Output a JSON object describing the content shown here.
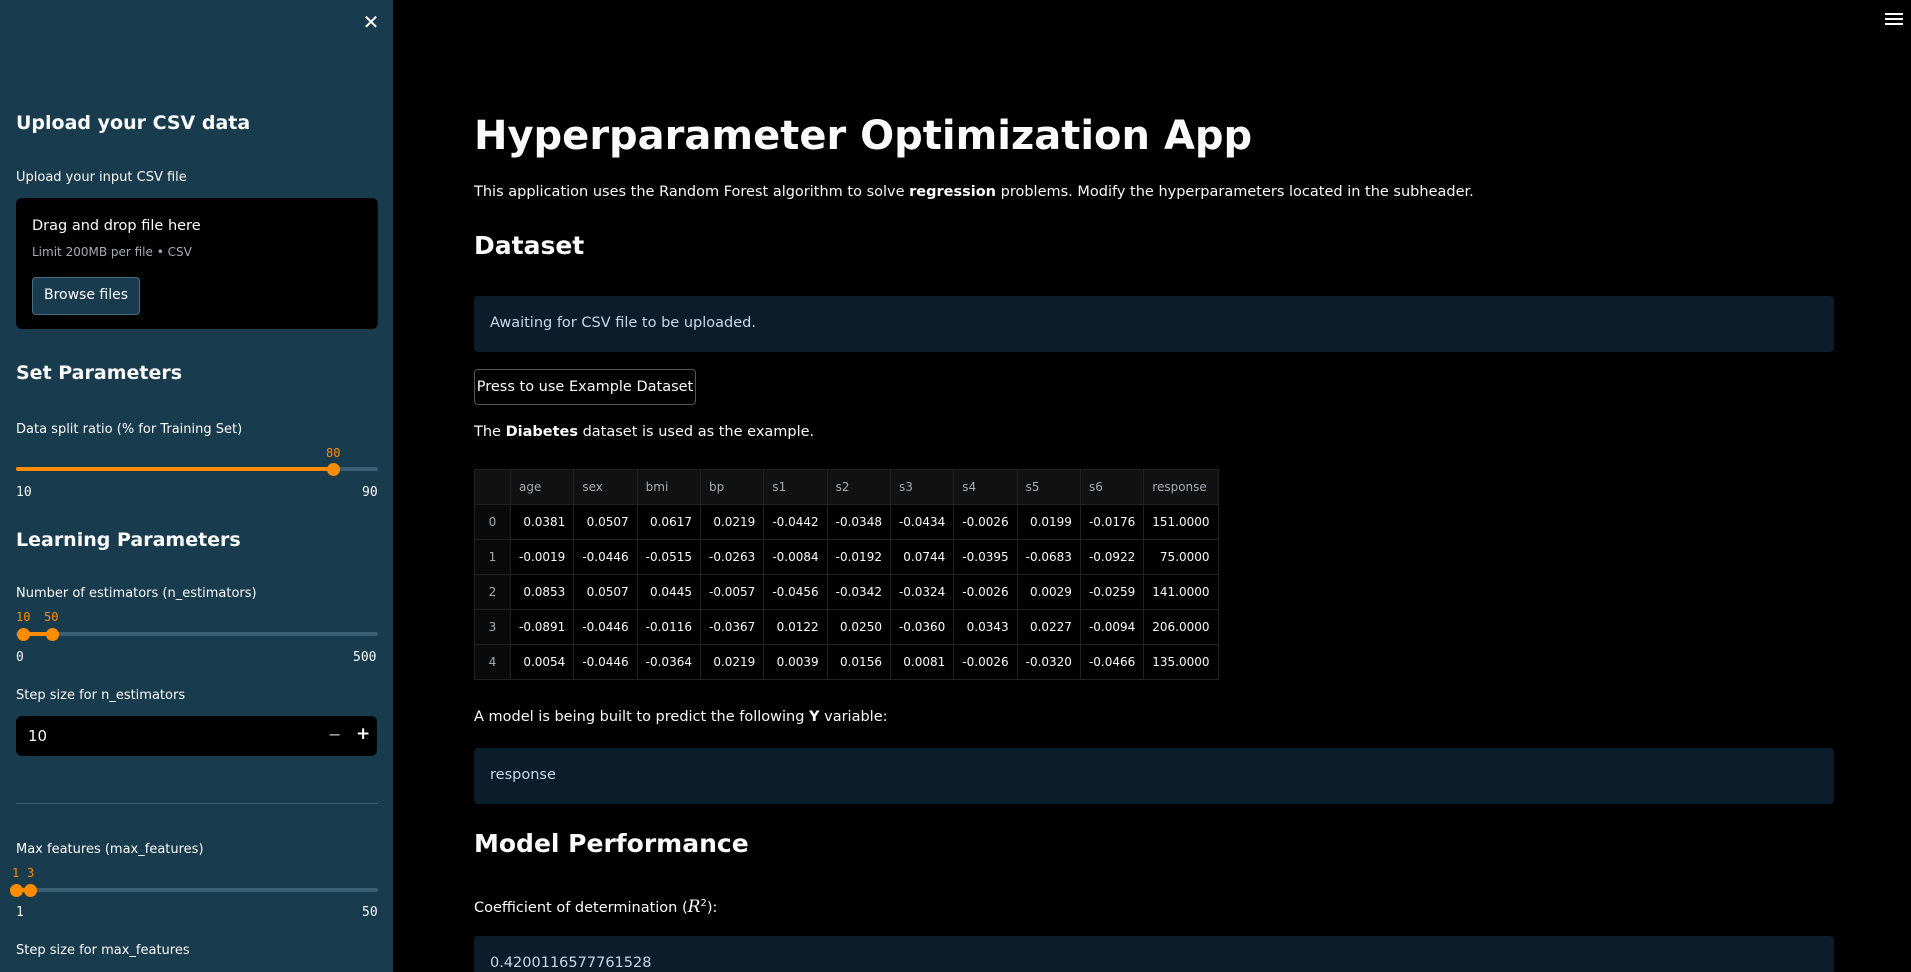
{
  "sidebar": {
    "close_icon": "close-icon",
    "upload_header": "Upload your CSV data",
    "upload_label": "Upload your input CSV file",
    "drag_text": "Drag and drop file here",
    "limit_text": "Limit 200MB per file • CSV",
    "browse_label": "Browse files",
    "set_params_header": "Set Parameters",
    "split_label": "Data split ratio (% for Training Set)",
    "split_value": "80",
    "split_min": "10",
    "split_max": "90",
    "learning_header": "Learning Parameters",
    "estimators_label": "Number of estimators (n_estimators)",
    "estimators_low": "10",
    "estimators_high": "50",
    "estimators_min": "0",
    "estimators_max": "500",
    "step_est_label": "Step size for n_estimators",
    "step_est_value": "10",
    "max_features_label": "Max features (max_features)",
    "max_features_low": "1",
    "max_features_high": "3",
    "max_features_min": "1",
    "max_features_max": "50",
    "step_mf_label": "Step size for max_features"
  },
  "main": {
    "title": "Hyperparameter Optimization App",
    "intro_pre": "This application uses the Random Forest algorithm to solve ",
    "intro_bold": "regression",
    "intro_post": " problems. Modify the hyperparameters located in the subheader.",
    "dataset_header": "Dataset",
    "awaiting": "Awaiting for CSV file to be uploaded.",
    "example_button": "Press to use Example Dataset",
    "example_pre": "The ",
    "example_bold": "Diabetes",
    "example_post": " dataset is used as the example.",
    "table": {
      "columns": [
        "age",
        "sex",
        "bmi",
        "bp",
        "s1",
        "s2",
        "s3",
        "s4",
        "s5",
        "s6",
        "response"
      ],
      "rows": [
        {
          "index": "0",
          "cells": [
            "0.0381",
            "0.0507",
            "0.0617",
            "0.0219",
            "-0.0442",
            "-0.0348",
            "-0.0434",
            "-0.0026",
            "0.0199",
            "-0.0176",
            "151.0000"
          ]
        },
        {
          "index": "1",
          "cells": [
            "-0.0019",
            "-0.0446",
            "-0.0515",
            "-0.0263",
            "-0.0084",
            "-0.0192",
            "0.0744",
            "-0.0395",
            "-0.0683",
            "-0.0922",
            "75.0000"
          ]
        },
        {
          "index": "2",
          "cells": [
            "0.0853",
            "0.0507",
            "0.0445",
            "-0.0057",
            "-0.0456",
            "-0.0342",
            "-0.0324",
            "-0.0026",
            "0.0029",
            "-0.0259",
            "141.0000"
          ]
        },
        {
          "index": "3",
          "cells": [
            "-0.0891",
            "-0.0446",
            "-0.0116",
            "-0.0367",
            "0.0122",
            "0.0250",
            "-0.0360",
            "0.0343",
            "0.0227",
            "-0.0094",
            "206.0000"
          ]
        },
        {
          "index": "4",
          "cells": [
            "0.0054",
            "-0.0446",
            "-0.0364",
            "0.0219",
            "0.0039",
            "0.0156",
            "0.0081",
            "-0.0026",
            "-0.0320",
            "-0.0466",
            "135.0000"
          ]
        }
      ]
    },
    "y_pre": "A model is being built to predict the following ",
    "y_bold": "Y",
    "y_post": " variable:",
    "y_value": "response",
    "performance_header": "Model Performance",
    "r2_label": "Coefficient of determination (",
    "r2_symbol": "R",
    "r2_sup": "2",
    "r2_close": "):",
    "r2_value": "0.4200116577761528"
  },
  "colors": {
    "sidebar_bg": "#193b4e",
    "accent": "#ff8c00",
    "info_bg": "#0b1c2a"
  }
}
